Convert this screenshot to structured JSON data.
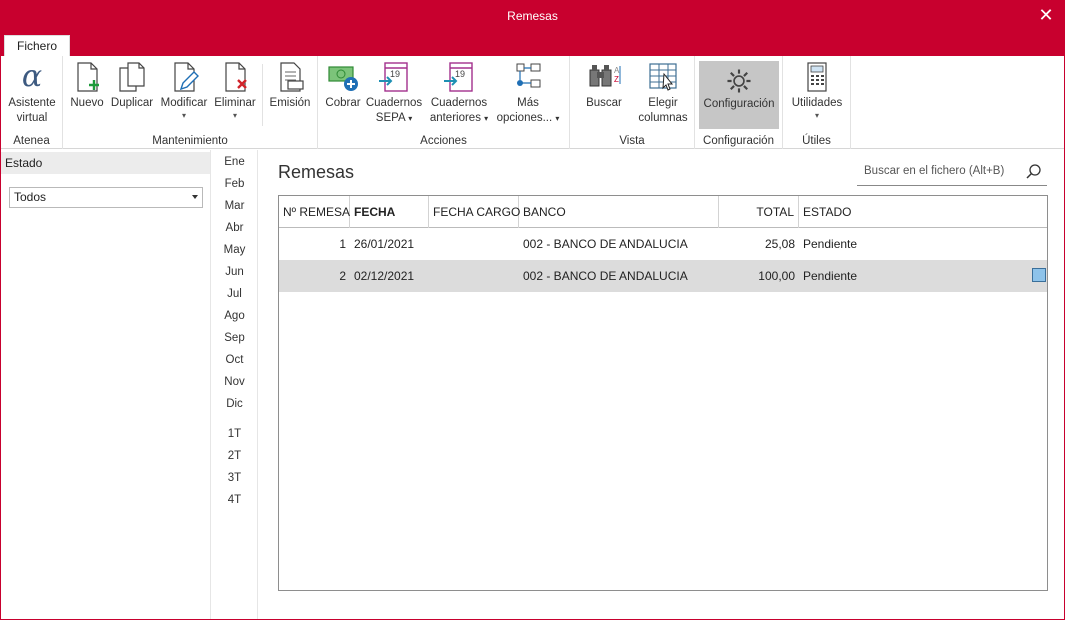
{
  "window": {
    "title": "Remesas",
    "close": "✕"
  },
  "tabs": [
    {
      "label": "Fichero"
    }
  ],
  "ribbon": {
    "atenea": {
      "label": "Atenea",
      "asistente": [
        "Asistente",
        "virtual"
      ]
    },
    "mantenimiento": {
      "label": "Mantenimiento",
      "nuevo": "Nuevo",
      "duplicar": "Duplicar",
      "modificar": "Modificar",
      "eliminar": "Eliminar",
      "emision": "Emisión"
    },
    "acciones": {
      "label": "Acciones",
      "cobrar": "Cobrar",
      "cuadernos_sepa": [
        "Cuadernos",
        "SEPA"
      ],
      "cuadernos_anteriores": [
        "Cuadernos",
        "anteriores"
      ],
      "mas_opciones": [
        "Más",
        "opciones..."
      ]
    },
    "vista": {
      "label": "Vista",
      "buscar": "Buscar",
      "elegir_columnas": [
        "Elegir",
        "columnas"
      ]
    },
    "configuracion": {
      "label": "Configuración",
      "configuracion": "Configuración"
    },
    "utiles": {
      "label": "Útiles",
      "utilidades": "Utilidades"
    },
    "dropdown_glyph": "▾",
    "alpha_glyph": "α"
  },
  "filter": {
    "header": "Estado",
    "selected": "Todos"
  },
  "periods": [
    "Ene",
    "Feb",
    "Mar",
    "Abr",
    "May",
    "Jun",
    "Jul",
    "Ago",
    "Sep",
    "Oct",
    "Nov",
    "Dic",
    "1T",
    "2T",
    "3T",
    "4T"
  ],
  "main": {
    "title": "Remesas",
    "search_placeholder": "Buscar en el fichero (Alt+B)"
  },
  "table": {
    "columns": [
      "Nº REMESA",
      "FECHA",
      "FECHA CARGO",
      "BANCO",
      "TOTAL",
      "ESTADO"
    ],
    "sorted_column": "FECHA",
    "rows": [
      {
        "num": "1",
        "fecha": "26/01/2021",
        "fecha_cargo": "",
        "banco": "002 - BANCO DE ANDALUCIA",
        "total": "25,08",
        "estado": "Pendiente",
        "selected": false
      },
      {
        "num": "2",
        "fecha": "02/12/2021",
        "fecha_cargo": "",
        "banco": "002 - BANCO DE ANDALUCIA",
        "total": "100,00",
        "estado": "Pendiente",
        "selected": true
      }
    ]
  },
  "colors": {
    "brand": "#c8002e",
    "selection": "#dcdcdc",
    "active_button": "#c6c6c6"
  }
}
